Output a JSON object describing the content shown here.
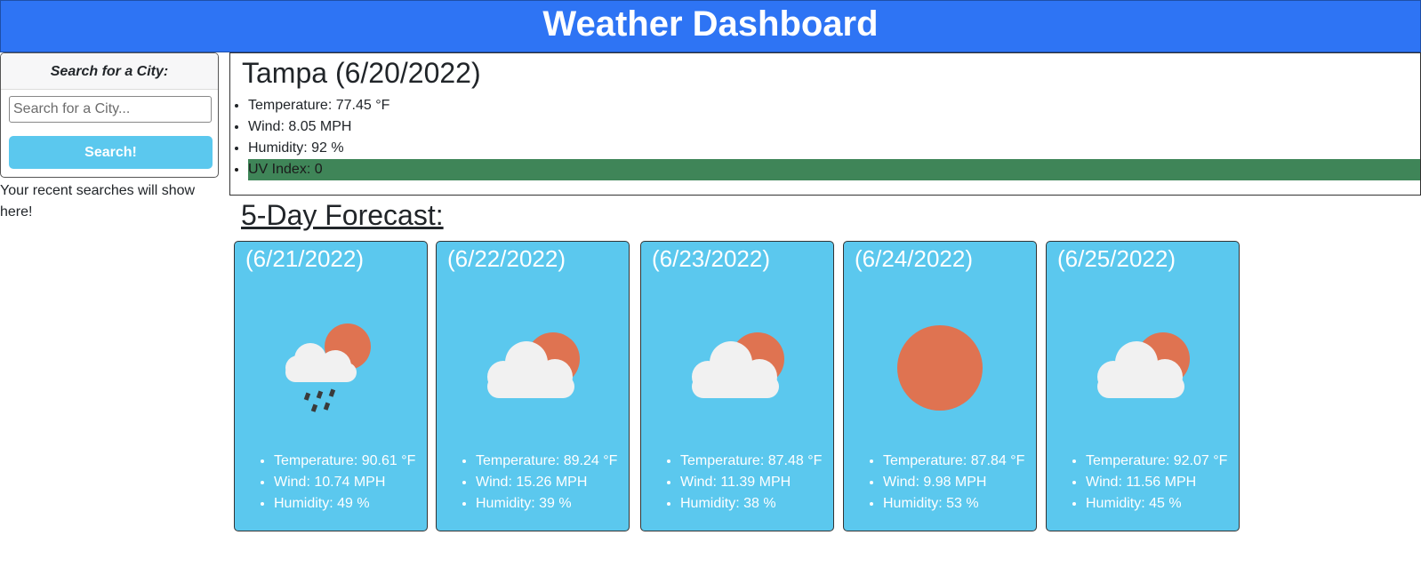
{
  "header": {
    "title": "Weather Dashboard"
  },
  "search": {
    "heading": "Search for a City:",
    "placeholder": "Search for a City...",
    "value": "",
    "button_label": "Search!",
    "recent_text": "Your recent searches will show here!"
  },
  "current": {
    "title": "Tampa (6/20/2022)",
    "temperature": "Temperature: 77.45 °F",
    "wind": "Wind: 8.05 MPH",
    "humidity": "Humidity: 92 %",
    "uv": "UV Index: 0",
    "uv_color": "#3f8558"
  },
  "forecast": {
    "heading": "5-Day Forecast:",
    "card_color": "#5bc8ee",
    "days": [
      {
        "date": "(6/21/2022)",
        "icon": "rain-cloud-sun-icon",
        "temperature": "Temperature: 90.61 °F",
        "wind": "Wind: 10.74 MPH",
        "humidity": "Humidity: 49 %"
      },
      {
        "date": "(6/22/2022)",
        "icon": "partly-cloudy-icon",
        "temperature": "Temperature: 89.24 °F",
        "wind": "Wind: 15.26 MPH",
        "humidity": "Humidity: 39 %"
      },
      {
        "date": "(6/23/2022)",
        "icon": "partly-cloudy-icon",
        "temperature": "Temperature: 87.48 °F",
        "wind": "Wind: 11.39 MPH",
        "humidity": "Humidity: 38 %"
      },
      {
        "date": "(6/24/2022)",
        "icon": "sun-icon",
        "temperature": "Temperature: 87.84 °F",
        "wind": "Wind: 9.98 MPH",
        "humidity": "Humidity: 53 %"
      },
      {
        "date": "(6/25/2022)",
        "icon": "partly-cloudy-icon",
        "temperature": "Temperature: 92.07 °F",
        "wind": "Wind: 11.56 MPH",
        "humidity": "Humidity: 45 %"
      }
    ]
  }
}
